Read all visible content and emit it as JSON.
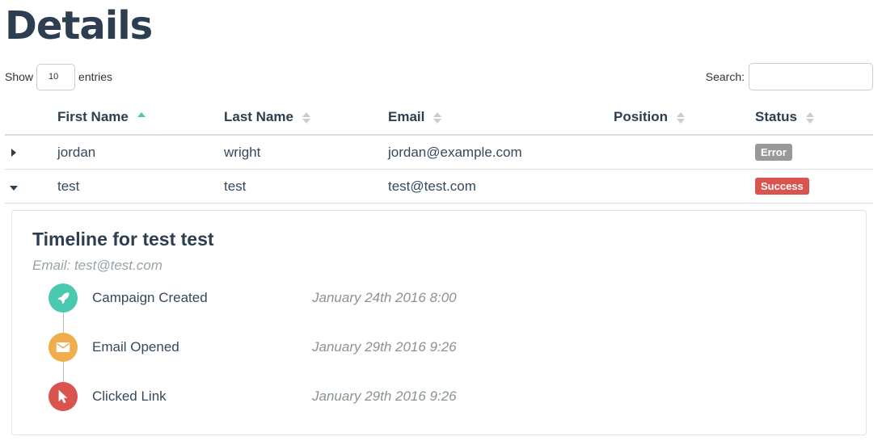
{
  "page": {
    "title": "Details"
  },
  "length_control": {
    "show_label": "Show",
    "entries_label": "entries",
    "selected": "10"
  },
  "search": {
    "label": "Search:",
    "value": ""
  },
  "table": {
    "columns": [
      "First Name",
      "Last Name",
      "Email",
      "Position",
      "Status"
    ],
    "sorted_column": "First Name",
    "rows": [
      {
        "first": "jordan",
        "last": "wright",
        "email": "jordan@example.com",
        "position": "",
        "status": "Error",
        "status_color": "#999999",
        "expanded": false
      },
      {
        "first": "test",
        "last": "test",
        "email": "test@test.com",
        "position": "",
        "status": "Success",
        "status_color": "#d9534f",
        "expanded": true
      }
    ]
  },
  "timeline": {
    "title": "Timeline for test test",
    "email": "Email: test@test.com",
    "events": [
      {
        "label": "Campaign Created",
        "time": "January 24th 2016 8:00",
        "icon": "rocket-icon",
        "color": "#48c9b0"
      },
      {
        "label": "Email Opened",
        "time": "January 29th 2016 9:26",
        "icon": "envelope-icon",
        "color": "#f0ad4e"
      },
      {
        "label": "Clicked Link",
        "time": "January 29th 2016 9:26",
        "icon": "cursor-icon",
        "color": "#d9534f"
      }
    ]
  },
  "colors": {
    "accent": "#48c9b0",
    "heading": "#2c3e50"
  }
}
